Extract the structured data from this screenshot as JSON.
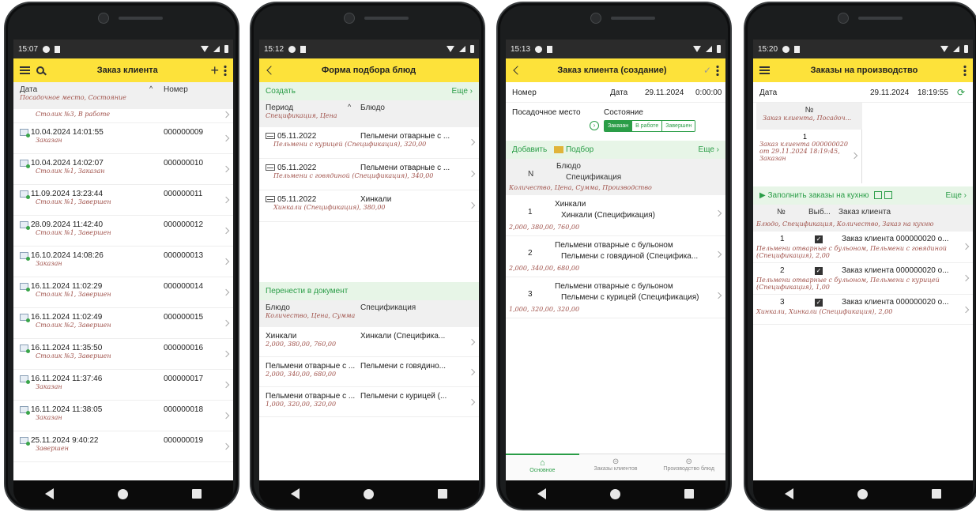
{
  "screens": {
    "s1": {
      "time": "15:07",
      "title": "Заказ клиента",
      "col_date": "Дата",
      "col_number": "Номер",
      "col_sub": "Посадочное место, Состояние",
      "first_sub": "Столик №3, В работе",
      "rows": [
        {
          "date": "10.04.2024 14:01:55",
          "num": "000000009",
          "sub": "Заказан"
        },
        {
          "date": "10.04.2024 14:02:07",
          "num": "000000010",
          "sub": "Столик №1, Заказан"
        },
        {
          "date": "11.09.2024 13:23:44",
          "num": "000000011",
          "sub": "Столик №1, Завершен"
        },
        {
          "date": "28.09.2024 11:42:40",
          "num": "000000012",
          "sub": "Столик №1, Завершен"
        },
        {
          "date": "16.10.2024 14:08:26",
          "num": "000000013",
          "sub": "Заказан"
        },
        {
          "date": "16.11.2024 11:02:29",
          "num": "000000014",
          "sub": "Столик №1, Завершен"
        },
        {
          "date": "16.11.2024 11:02:49",
          "num": "000000015",
          "sub": "Столик №2, Завершен"
        },
        {
          "date": "16.11.2024 11:35:50",
          "num": "000000016",
          "sub": "Столик №3, Завершен"
        },
        {
          "date": "16.11.2024 11:37:46",
          "num": "000000017",
          "sub": "Заказан"
        },
        {
          "date": "16.11.2024 11:38:05",
          "num": "000000018",
          "sub": "Заказан"
        },
        {
          "date": "25.11.2024 9:40:22",
          "num": "000000019",
          "sub": "Завершен"
        }
      ]
    },
    "s2": {
      "time": "15:12",
      "title": "Форма подбора блюд",
      "create": "Создать",
      "more": "Еще",
      "col_period": "Период",
      "col_dish": "Блюдо",
      "col_sub": "Спецификация, Цена",
      "rows": [
        {
          "date": "05.11.2022",
          "dish": "Пельмени отварные с ...",
          "sub": "Пельмени с курицей (Спецификация), 320,00"
        },
        {
          "date": "05.11.2022",
          "dish": "Пельмени отварные с ...",
          "sub": "Пельмени с говядиной (Спецификация), 340,00"
        },
        {
          "date": "05.11.2022",
          "dish": "Хинкали",
          "sub": "Хинкали (Спецификация), 380,00"
        }
      ],
      "transfer": "Перенести в документ",
      "col2_dish": "Блюдо",
      "col2_spec": "Спецификация",
      "col2_sub": "Количество, Цена, Сумма",
      "rows2": [
        {
          "dish": "Хинкали",
          "spec": "Хинкали (Специфика...",
          "sub": "2,000, 380,00, 760,00"
        },
        {
          "dish": "Пельмени отварные с ...",
          "spec": "Пельмени с говядино...",
          "sub": "2,000, 340,00, 680,00"
        },
        {
          "dish": "Пельмени отварные с ...",
          "spec": "Пельмени с курицей (...",
          "sub": "1,000, 320,00, 320,00"
        }
      ]
    },
    "s3": {
      "time": "15:13",
      "title": "Заказ клиента (создание)",
      "num_label": "Номер",
      "date_label": "Дата",
      "date_val": "29.11.2024",
      "time_val": "0:00:00",
      "seat_label": "Посадочное место",
      "state_label": "Состояние",
      "states": [
        "Заказан",
        "В работе",
        "Завершен"
      ],
      "add": "Добавить",
      "pick": "Подбор",
      "more": "Еще",
      "col_n": "N",
      "col_dish": "Блюдо",
      "col_spec": "Спецификация",
      "col_sub": "Количество, Цена, Сумма, Производство",
      "rows": [
        {
          "n": "1",
          "dish": "Хинкали",
          "spec": "Хинкали (Спецификация)",
          "sub": "2,000, 380,00, 760,00"
        },
        {
          "n": "2",
          "dish": "Пельмени отварные с бульоном",
          "spec": "Пельмени с говядиной (Специфика...",
          "sub": "2,000, 340,00, 680,00"
        },
        {
          "n": "3",
          "dish": "Пельмени отварные с бульоном",
          "spec": "Пельмени с курицей (Спецификация)",
          "sub": "1,000, 320,00, 320,00"
        }
      ],
      "tabs": [
        "Основное",
        "Заказы клиентов",
        "Производство блюд"
      ]
    },
    "s4": {
      "time": "15:20",
      "title": "Заказы на производство",
      "date_label": "Дата",
      "date_val": "29.11.2024",
      "time_val": "18:19:55",
      "col_no": "№",
      "col_sub": "Заказ клиента, Посадоч...",
      "card_no": "1",
      "card_sub": "Заказ клиента 000000020 от 29.11.2024 18:19:45, Заказан",
      "fill": "Заполнить заказы на кухню",
      "more": "Еще",
      "t_no": "№",
      "t_sel": "Выб...",
      "t_order": "Заказ клиента",
      "t_sub": "Блюдо, Спецификация, Количество, Заказ на кухню",
      "rows": [
        {
          "n": "1",
          "order": "Заказ клиента 000000020 о...",
          "sub": "Пельмени отварные с бульоном, Пельмени с говядиной (Спецификация), 2,00"
        },
        {
          "n": "2",
          "order": "Заказ клиента 000000020 о...",
          "sub": "Пельмени отварные с бульоном, Пельмени с курицей (Спецификация), 1,00"
        },
        {
          "n": "3",
          "order": "Заказ клиента 000000020 о...",
          "sub": "Хинкали, Хинкали (Спецификация), 2,00"
        }
      ]
    }
  }
}
